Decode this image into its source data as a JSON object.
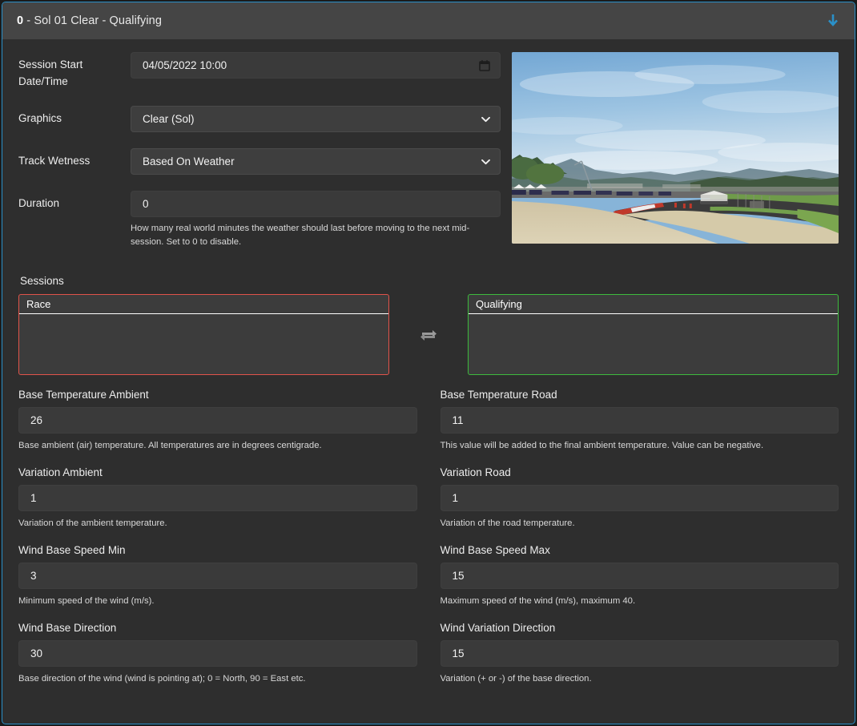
{
  "header": {
    "index": "0",
    "title_rest": " - Sol 01 Clear - Qualifying",
    "collapse_icon": "arrow-down-icon"
  },
  "top_form": {
    "session_start": {
      "label": "Session Start Date/Time",
      "value": "04/05/2022 10:00",
      "icon": "calendar-icon"
    },
    "graphics": {
      "label": "Graphics",
      "value": "Clear (Sol)"
    },
    "track_wetness": {
      "label": "Track Wetness",
      "value": "Based On Weather"
    },
    "duration": {
      "label": "Duration",
      "value": "0",
      "helper": "How many real world minutes the weather should last before moving to the next mid-session. Set to 0 to disable."
    }
  },
  "preview": {
    "alt": "race-track-preview"
  },
  "sessions": {
    "title": "Sessions",
    "left_box": {
      "name": "Race",
      "accent": "#e0534a"
    },
    "swap_icon": "swap-arrows-icon",
    "right_box": {
      "name": "Qualifying",
      "accent": "#3dba3d"
    }
  },
  "settings": [
    {
      "label": "Base Temperature Ambient",
      "value": "26",
      "helper": "Base ambient (air) temperature. All temperatures are in degrees centigrade."
    },
    {
      "label": "Base Temperature Road",
      "value": "11",
      "helper": "This value will be added to the final ambient temperature. Value can be negative."
    },
    {
      "label": "Variation Ambient",
      "value": "1",
      "helper": "Variation of the ambient temperature."
    },
    {
      "label": "Variation Road",
      "value": "1",
      "helper": "Variation of the road temperature."
    },
    {
      "label": "Wind Base Speed Min",
      "value": "3",
      "helper": "Minimum speed of the wind (m/s)."
    },
    {
      "label": "Wind Base Speed Max",
      "value": "15",
      "helper": "Maximum speed of the wind (m/s), maximum 40."
    },
    {
      "label": "Wind Base Direction",
      "value": "30",
      "helper": "Base direction of the wind (wind is pointing at); 0 = North, 90 = East etc."
    },
    {
      "label": "Wind Variation Direction",
      "value": "15",
      "helper": "Variation (+ or -) of the base direction."
    }
  ],
  "colors": {
    "accent_border": "#2a90c8",
    "header_bg": "#454545",
    "panel_bg": "#2e2e2e",
    "input_bg": "#3a3a3a",
    "select_bg": "#3e3e3e",
    "arrow_blue": "#2a90c8",
    "session_red": "#e0534a",
    "session_green": "#3dba3d"
  }
}
